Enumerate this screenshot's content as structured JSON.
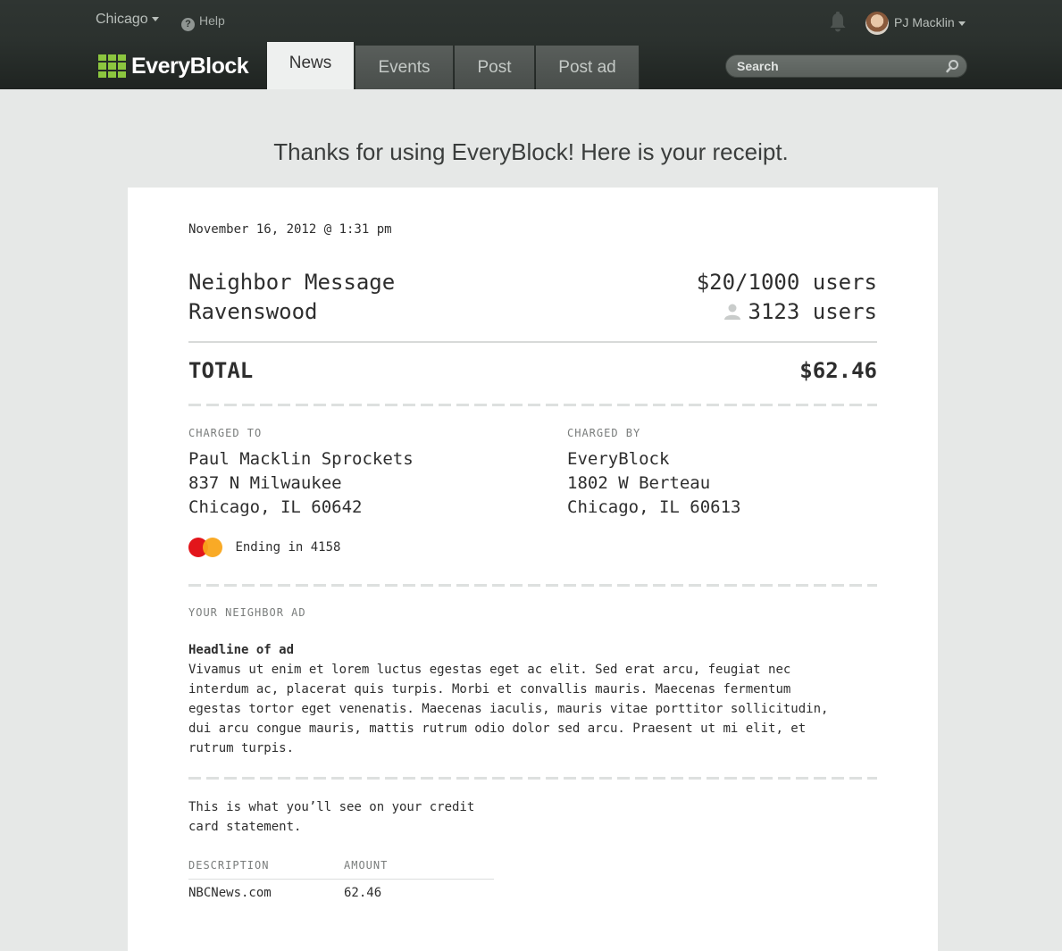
{
  "header": {
    "city": "Chicago",
    "help": "Help",
    "user": "PJ Macklin",
    "logo": "EveryBlock",
    "tabs": [
      {
        "label": "News",
        "active": true
      },
      {
        "label": "Events",
        "active": false
      },
      {
        "label": "Post",
        "active": false
      },
      {
        "label": "Post ad",
        "active": false
      }
    ],
    "search_placeholder": "Search"
  },
  "thanks": "Thanks for using EveryBlock! Here is your receipt.",
  "receipt": {
    "date": "November 16, 2012 @ 1:31 pm",
    "item": "Neighbor Message",
    "rate": "$20/1000 users",
    "location": "Ravenswood",
    "users": "3123 users",
    "total_label": "TOTAL",
    "total": "$62.46",
    "charged_to": {
      "label": "CHARGED TO",
      "lines": [
        "Paul Macklin Sprockets",
        "837 N Milwaukee",
        "Chicago, IL 60642"
      ]
    },
    "charged_by": {
      "label": "CHARGED BY",
      "lines": [
        "EveryBlock",
        "1802 W Berteau",
        "Chicago, IL 60613"
      ]
    },
    "card_brand": "MasterCard",
    "card_ending": "Ending in 4158",
    "ad_label": "YOUR NEIGHBOR AD",
    "ad_headline": "Headline of ad",
    "ad_body_lines": [
      "Vivamus ut enim et lorem luctus egestas eget ac elit. Sed erat arcu, feugiat nec",
      "interdum ac, placerat quis turpis. Morbi et convallis mauris. Maecenas fermentum",
      "egestas tortor eget venenatis. Maecenas iaculis, mauris vitae porttitor sollicitudin,",
      "dui arcu congue mauris, mattis rutrum odio dolor sed arcu. Praesent ut mi elit, et",
      "rutrum turpis."
    ],
    "statement_lines": [
      "This is what you’ll see on your credit",
      "card statement."
    ],
    "statement_table": {
      "headers": [
        "DESCRIPTION",
        "AMOUNT"
      ],
      "rows": [
        [
          "NBCNews.com",
          "62.46"
        ]
      ]
    }
  },
  "colors": {
    "accent": "#8cc63f",
    "header_bg": "#2b312e",
    "page_bg": "#e6e8e7"
  }
}
